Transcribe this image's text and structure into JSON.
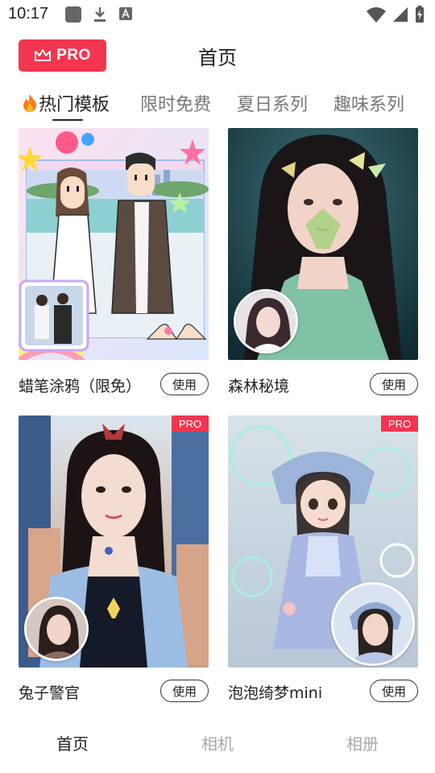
{
  "status_bar": {
    "time": "10:17",
    "icons": [
      "app-square-icon",
      "download-icon",
      "a-badge-icon",
      "wifi-icon",
      "signal-icon",
      "battery-charging-icon"
    ]
  },
  "header": {
    "pro_label": "PRO",
    "title": "首页"
  },
  "tabs": [
    {
      "label": "热门模板",
      "icon": "fire-icon"
    },
    {
      "label": "限时免费"
    },
    {
      "label": "夏日系列"
    },
    {
      "label": "趣味系列"
    }
  ],
  "cards": [
    {
      "title": "蜡笔涂鸦（限免）",
      "button": "使用"
    },
    {
      "title": "森林秘境",
      "button": "使用"
    },
    {
      "title": "兔子警官",
      "button": "使用",
      "badge": "PRO"
    },
    {
      "title": "泡泡绮梦mini",
      "button": "使用",
      "badge": "PRO"
    }
  ],
  "bottom_nav": [
    {
      "label": "首页"
    },
    {
      "label": "相机"
    },
    {
      "label": "相册"
    }
  ],
  "colors": {
    "accent": "#f3364f",
    "text_primary": "#222222",
    "text_inactive": "#777777",
    "nav_inactive": "#aaaaaa"
  }
}
